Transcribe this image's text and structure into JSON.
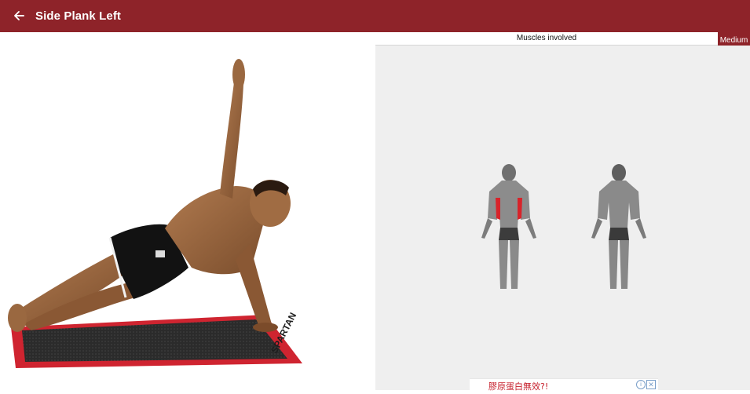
{
  "appbar": {
    "title": "Side Plank Left",
    "back_icon": "arrow-left-icon",
    "background": "#8e2329"
  },
  "exercise": {
    "illustration": "side-plank-figure",
    "mat_brand": "SPARTAN"
  },
  "muscles": {
    "header": "Muscles involved",
    "level": "Medium",
    "highlight_color": "#d8232a"
  },
  "ad": {
    "text": "膠原蛋白無效?!",
    "info_icon": "info-icon",
    "close_icon": "close-icon"
  }
}
